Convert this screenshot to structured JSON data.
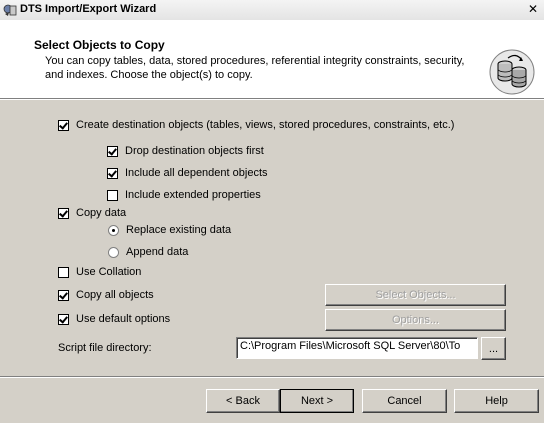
{
  "window": {
    "title": "DTS Import/Export Wizard",
    "close_glyph": "✕"
  },
  "header": {
    "title": "Select Objects to Copy",
    "description": "You can copy tables, data, stored procedures, referential integrity constraints, security, and indexes.  Choose the object(s) to copy.",
    "logo_icon": "database-copy-icon"
  },
  "options": {
    "create_destination": {
      "label": "Create destination objects (tables, views, stored procedures, constraints, etc.)",
      "checked": true
    },
    "drop_destination": {
      "label": "Drop destination objects first",
      "checked": true
    },
    "include_dependent": {
      "label": "Include all dependent objects",
      "checked": true
    },
    "include_extended": {
      "label": "Include extended properties",
      "checked": false
    },
    "copy_data": {
      "label": "Copy data",
      "checked": true
    },
    "replace_existing": {
      "label": "Replace existing data",
      "selected": true
    },
    "append_data": {
      "label": "Append data",
      "selected": false
    },
    "use_collation": {
      "label": "Use Collation",
      "checked": false
    },
    "copy_all_objects": {
      "label": "Copy all objects",
      "checked": true
    },
    "use_default_options": {
      "label": "Use default options",
      "checked": true
    }
  },
  "buttons": {
    "select_objects": "Select Objects...",
    "options": "Options...",
    "browse": "...",
    "back": "< Back",
    "next": "Next >",
    "cancel": "Cancel",
    "help": "Help"
  },
  "script_dir": {
    "label": "Script file directory:",
    "value": "C:\\Program Files\\Microsoft SQL Server\\80\\To"
  }
}
